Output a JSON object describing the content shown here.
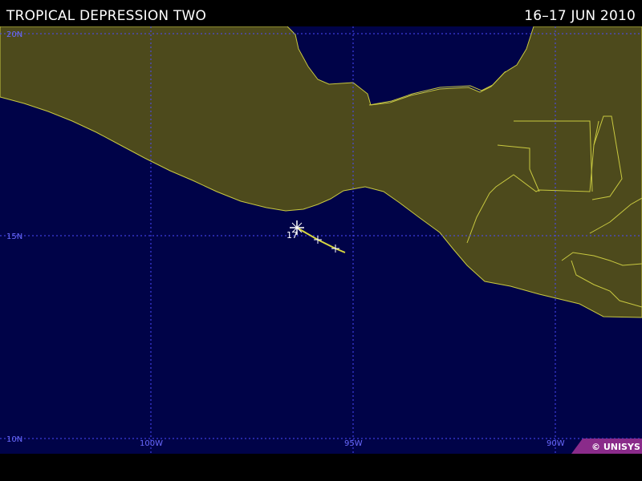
{
  "header": {
    "title": "TROPICAL DEPRESSION TWO",
    "date": "16–17 JUN 2010"
  },
  "map": {
    "colors": {
      "ocean": "#000348",
      "land": "#4d4a1c",
      "coast": "#c8c840",
      "grid": "#4a4aff",
      "track": "#d8d840"
    },
    "lat_labels": [
      "20N",
      "15N",
      "10N"
    ],
    "lon_labels": [
      "100W",
      "95W",
      "90W"
    ],
    "storm": {
      "day_label": "17",
      "current_marker_icon": "storm-cross-icon",
      "track_points": [
        {
          "lat": 14.4,
          "lon": -94.8
        },
        {
          "lat": 14.7,
          "lon": -95.7
        },
        {
          "lat": 15.2,
          "lon": -96.4
        }
      ]
    }
  },
  "footer": {
    "credit": "© UNISYS"
  }
}
